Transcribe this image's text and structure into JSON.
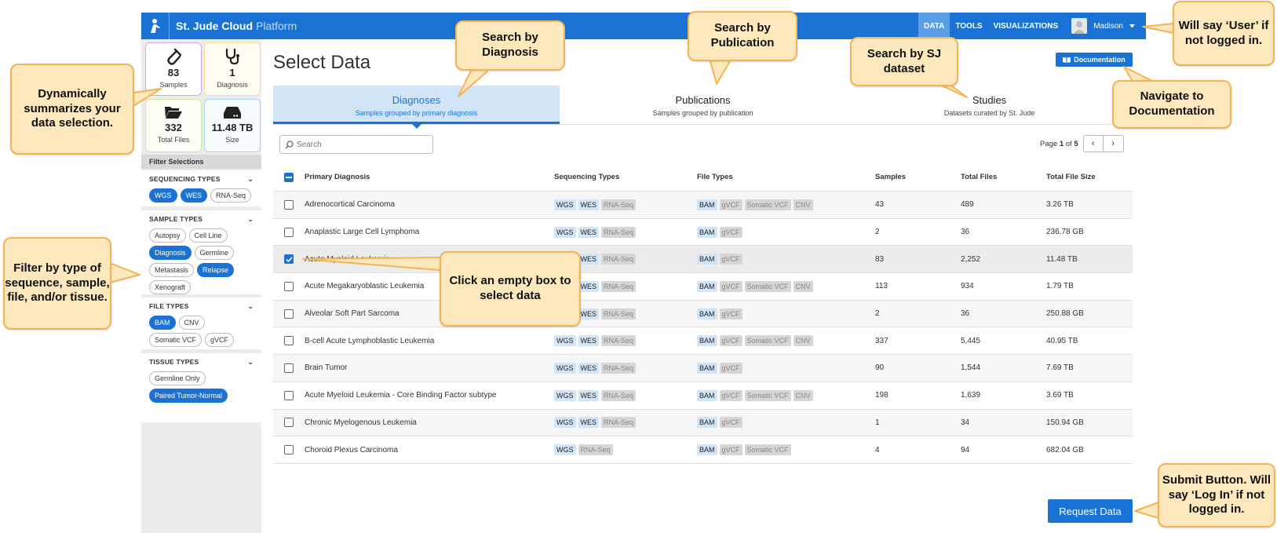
{
  "header": {
    "brand": "St. Jude Cloud",
    "brand_sub": "Platform",
    "nav": [
      "DATA",
      "TOOLS",
      "VISUALIZATIONS"
    ],
    "user": "Madison"
  },
  "stats": {
    "samples": {
      "value": "83",
      "label": "Samples"
    },
    "diagnoses": {
      "value": "1",
      "label": "Diagnosis"
    },
    "files": {
      "value": "332",
      "label": "Total Files"
    },
    "size": {
      "value": "11.48 TB",
      "label": "Size"
    }
  },
  "sidebar": {
    "filter_heading": "Filter Selections",
    "sections": [
      {
        "title": "SEQUENCING TYPES",
        "pills": [
          {
            "label": "WGS",
            "on": true
          },
          {
            "label": "WES",
            "on": true
          },
          {
            "label": "RNA-Seq",
            "on": false
          }
        ]
      },
      {
        "title": "SAMPLE TYPES",
        "pills": [
          {
            "label": "Autopsy",
            "on": false
          },
          {
            "label": "Cell Line",
            "on": false
          },
          {
            "label": "Diagnosis",
            "on": true
          },
          {
            "label": "Germline",
            "on": false
          },
          {
            "label": "Metastasis",
            "on": false
          },
          {
            "label": "Relapse",
            "on": true
          },
          {
            "label": "Xenograft",
            "on": false
          }
        ]
      },
      {
        "title": "FILE TYPES",
        "pills": [
          {
            "label": "BAM",
            "on": true
          },
          {
            "label": "CNV",
            "on": false
          },
          {
            "label": "Somatic VCF",
            "on": false
          },
          {
            "label": "gVCF",
            "on": false
          }
        ]
      },
      {
        "title": "TISSUE TYPES",
        "pills": [
          {
            "label": "Germline Only",
            "on": false
          },
          {
            "label": "Paired Tumor-Normal",
            "on": true
          }
        ]
      }
    ]
  },
  "main": {
    "title": "Select Data",
    "doc_button": "Documentation",
    "tabs": [
      {
        "label": "Diagnoses",
        "sub": "Samples grouped by primary diagnosis",
        "active": true
      },
      {
        "label": "Publications",
        "sub": "Samples grouped by publication",
        "active": false
      },
      {
        "label": "Studies",
        "sub": "Datasets curated by St. Jude",
        "active": false
      }
    ],
    "search_placeholder": "Search",
    "pager": {
      "prefix": "Page",
      "current": "1",
      "of": "of",
      "total": "5"
    },
    "request_button": "Request Data"
  },
  "table": {
    "headers": [
      "Primary Diagnosis",
      "Sequencing Types",
      "File Types",
      "Samples",
      "Total Files",
      "Total File Size"
    ],
    "rows": [
      {
        "diagnosis": "Adrenocortical Carcinoma",
        "seq": [
          [
            "WGS",
            1
          ],
          [
            "WES",
            1
          ],
          [
            "RNA-Seq",
            0
          ]
        ],
        "files": [
          [
            "BAM",
            1
          ],
          [
            "gVCF",
            0
          ],
          [
            "Somatic VCF",
            0
          ],
          [
            "CNV",
            0
          ]
        ],
        "samples": "43",
        "total_files": "489",
        "size": "3.26 TB",
        "checked": false
      },
      {
        "diagnosis": "Anaplastic Large Cell Lymphoma",
        "seq": [
          [
            "WGS",
            1
          ],
          [
            "WES",
            1
          ],
          [
            "RNA-Seq",
            0
          ]
        ],
        "files": [
          [
            "BAM",
            1
          ],
          [
            "gVCF",
            0
          ]
        ],
        "samples": "2",
        "total_files": "36",
        "size": "236.78 GB",
        "checked": false
      },
      {
        "diagnosis": "Acute Myeloid Leukemia",
        "seq": [
          [
            "WGS",
            1
          ],
          [
            "WES",
            1
          ],
          [
            "RNA-Seq",
            0
          ]
        ],
        "files": [
          [
            "BAM",
            1
          ],
          [
            "gVCF",
            0
          ]
        ],
        "samples": "83",
        "total_files": "2,252",
        "size": "11.48 TB",
        "checked": true
      },
      {
        "diagnosis": "Acute Megakaryoblastic Leukemia",
        "seq": [
          [
            "WGS",
            1
          ],
          [
            "WES",
            1
          ],
          [
            "RNA-Seq",
            0
          ]
        ],
        "files": [
          [
            "BAM",
            1
          ],
          [
            "gVCF",
            0
          ],
          [
            "Somatic VCF",
            0
          ],
          [
            "CNV",
            0
          ]
        ],
        "samples": "113",
        "total_files": "934",
        "size": "1.79 TB",
        "checked": false
      },
      {
        "diagnosis": "Alveolar Soft Part Sarcoma",
        "seq": [
          [
            "WGS",
            1
          ],
          [
            "WES",
            1
          ],
          [
            "RNA-Seq",
            0
          ]
        ],
        "files": [
          [
            "BAM",
            1
          ],
          [
            "gVCF",
            0
          ]
        ],
        "samples": "2",
        "total_files": "36",
        "size": "250.88 GB",
        "checked": false
      },
      {
        "diagnosis": "B-cell Acute Lymphoblastic Leukemia",
        "seq": [
          [
            "WGS",
            1
          ],
          [
            "WES",
            1
          ],
          [
            "RNA-Seq",
            0
          ]
        ],
        "files": [
          [
            "BAM",
            1
          ],
          [
            "gVCF",
            0
          ],
          [
            "Somatic VCF",
            0
          ],
          [
            "CNV",
            0
          ]
        ],
        "samples": "337",
        "total_files": "5,445",
        "size": "40.95 TB",
        "checked": false
      },
      {
        "diagnosis": "Brain Tumor",
        "seq": [
          [
            "WGS",
            1
          ],
          [
            "WES",
            1
          ],
          [
            "RNA-Seq",
            0
          ]
        ],
        "files": [
          [
            "BAM",
            1
          ],
          [
            "gVCF",
            0
          ]
        ],
        "samples": "90",
        "total_files": "1,544",
        "size": "7.69 TB",
        "checked": false
      },
      {
        "diagnosis": "Acute Myeloid Leukemia - Core Binding Factor subtype",
        "seq": [
          [
            "WGS",
            1
          ],
          [
            "WES",
            1
          ],
          [
            "RNA-Seq",
            0
          ]
        ],
        "files": [
          [
            "BAM",
            1
          ],
          [
            "gVCF",
            0
          ],
          [
            "Somatic VCF",
            0
          ],
          [
            "CNV",
            0
          ]
        ],
        "samples": "198",
        "total_files": "1,639",
        "size": "3.69 TB",
        "checked": false
      },
      {
        "diagnosis": "Chronic Myelogenous Leukemia",
        "seq": [
          [
            "WGS",
            1
          ],
          [
            "WES",
            1
          ],
          [
            "RNA-Seq",
            0
          ]
        ],
        "files": [
          [
            "BAM",
            1
          ],
          [
            "gVCF",
            0
          ]
        ],
        "samples": "1",
        "total_files": "34",
        "size": "150.94 GB",
        "checked": false
      },
      {
        "diagnosis": "Choroid Plexus Carcinoma",
        "seq": [
          [
            "WGS",
            1
          ],
          [
            "RNA-Seq",
            0
          ]
        ],
        "files": [
          [
            "BAM",
            1
          ],
          [
            "gVCF",
            0
          ],
          [
            "Somatic VCF",
            0
          ]
        ],
        "samples": "4",
        "total_files": "94",
        "size": "682.04 GB",
        "checked": false
      }
    ]
  },
  "callouts": {
    "summary": "Dynamically summarizes your data selection.",
    "filter": "Filter by type of sequence, sample, file, and/or tissue.",
    "diagnosis": "Search by Diagnosis",
    "publication": "Search by Publication",
    "dataset": "Search by SJ dataset",
    "user": "Will say ‘User’ if not logged in.",
    "docs": "Navigate to Documentation",
    "select": "Click an empty box to select data",
    "submit": "Submit Button. Will say ‘Log In’ if not logged in."
  }
}
